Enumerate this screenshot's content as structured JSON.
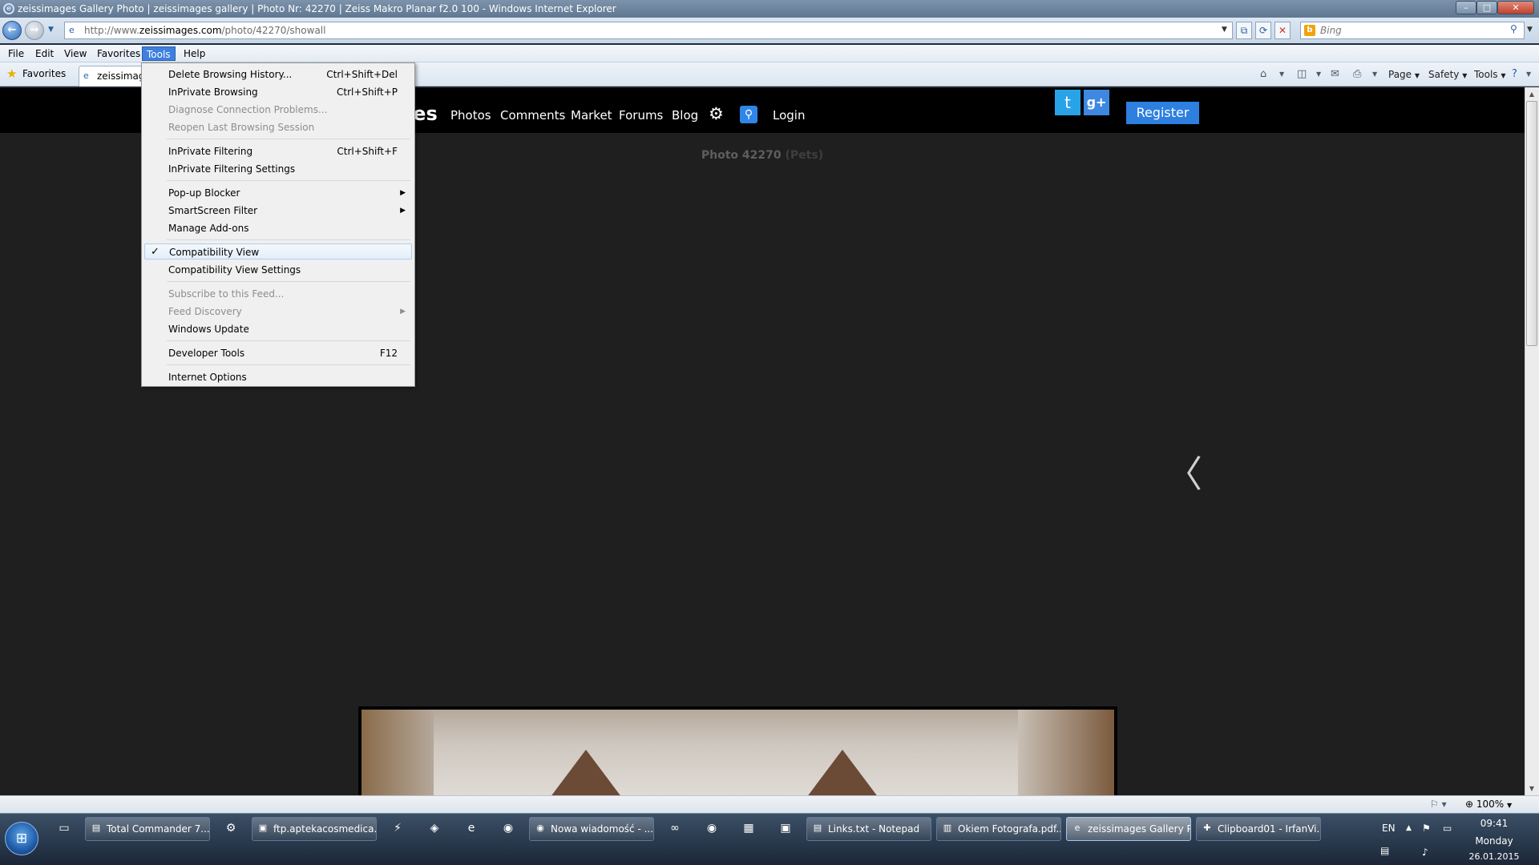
{
  "window": {
    "title": "zeissimages Gallery Photo | zeissimages gallery | Photo Nr: 42270 | Zeiss Makro Planar f2.0 100 - Windows Internet Explorer",
    "minimize": "–",
    "maximize": "□",
    "close": "✕"
  },
  "address": {
    "url_prefix": "http://www.",
    "url_domain": "zeissimages.com",
    "url_path": "/photo/42270/showall",
    "search_placeholder": "Bing"
  },
  "menubar": [
    "File",
    "Edit",
    "View",
    "Favorites",
    "Tools",
    "Help"
  ],
  "favorites": {
    "label": "Favorites",
    "tab_label": "zeissimages Gallery Photo | zeissim"
  },
  "command_bar": {
    "page": "Page",
    "safety": "Safety",
    "tools": "Tools"
  },
  "site": {
    "logo": "ges",
    "nav": [
      "Photos",
      "Comments",
      "Market",
      "Forums",
      "Blog"
    ],
    "login": "Login",
    "register": "Register",
    "twitter": "t",
    "gplus": "g+",
    "photo_title": "Photo 42270",
    "photo_category": "(Pets)"
  },
  "tools_menu": {
    "items": [
      {
        "label": "Delete Browsing History...",
        "shortcut": "Ctrl+Shift+Del",
        "disabled": false
      },
      {
        "label": "InPrivate Browsing",
        "shortcut": "Ctrl+Shift+P",
        "disabled": false
      },
      {
        "label": "Diagnose Connection Problems...",
        "shortcut": "",
        "disabled": true
      },
      {
        "label": "Reopen Last Browsing Session",
        "shortcut": "",
        "disabled": true
      },
      {
        "label": "InPrivate Filtering",
        "shortcut": "Ctrl+Shift+F",
        "disabled": false
      },
      {
        "label": "InPrivate Filtering Settings",
        "shortcut": "",
        "disabled": false
      },
      {
        "label": "Pop-up Blocker",
        "shortcut": "",
        "disabled": false,
        "submenu": true
      },
      {
        "label": "SmartScreen Filter",
        "shortcut": "",
        "disabled": false,
        "submenu": true
      },
      {
        "label": "Manage Add-ons",
        "shortcut": "",
        "disabled": false
      },
      {
        "label": "Compatibility View",
        "shortcut": "",
        "disabled": false,
        "checked": true
      },
      {
        "label": "Compatibility View Settings",
        "shortcut": "",
        "disabled": false
      },
      {
        "label": "Subscribe to this Feed...",
        "shortcut": "",
        "disabled": true
      },
      {
        "label": "Feed Discovery",
        "shortcut": "",
        "disabled": true,
        "submenu": true
      },
      {
        "label": "Windows Update",
        "shortcut": "",
        "disabled": false
      },
      {
        "label": "Developer Tools",
        "shortcut": "F12",
        "disabled": false
      },
      {
        "label": "Internet Options",
        "shortcut": "",
        "disabled": false
      }
    ]
  },
  "status": {
    "zoom": "100%"
  },
  "taskbar": {
    "items": [
      "Total Commander 7....",
      "ftp.aptekacosmedica...",
      "Nowa wiadomość - ...",
      "Links.txt - Notepad",
      "Okiem Fotografa.pdf...",
      "zeissimages Gallery P...",
      "Clipboard01 - IrfanVi..."
    ],
    "language": "EN",
    "time": "09:41",
    "day": "Monday",
    "date": "26.01.2015"
  }
}
